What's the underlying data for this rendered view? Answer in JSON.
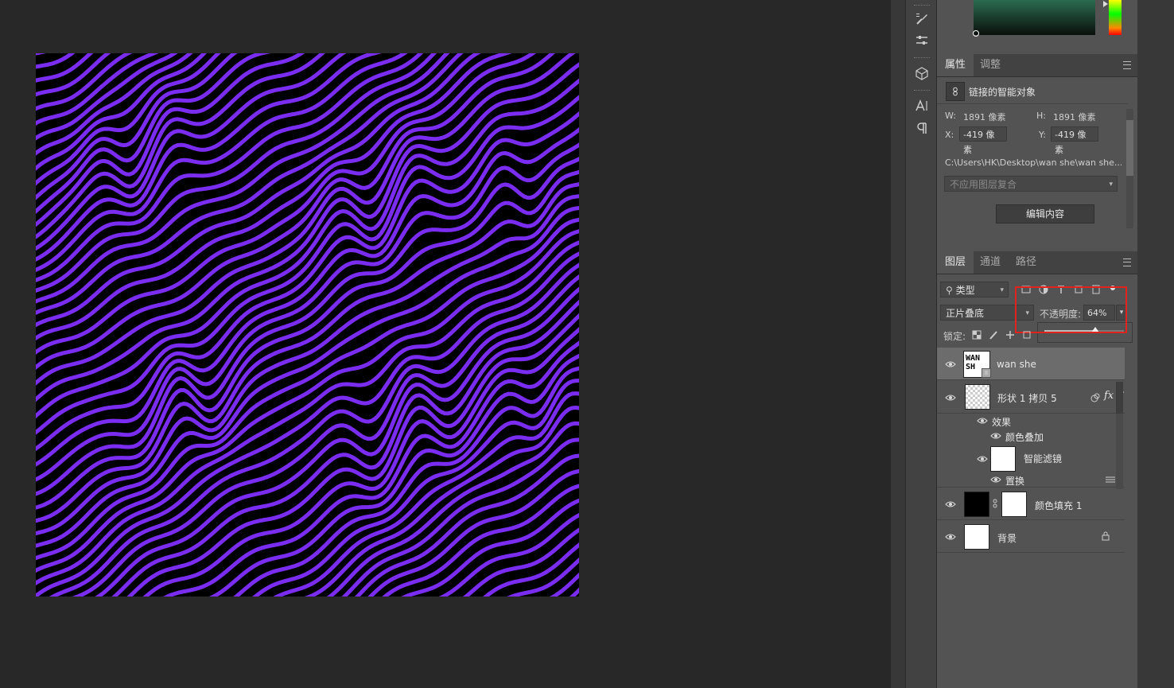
{
  "properties_panel": {
    "tabs": [
      "属性",
      "调整"
    ],
    "object_type": "链接的智能对象",
    "w_label": "W:",
    "w_value": "1891 像素",
    "h_label": "H:",
    "h_value": "1891 像素",
    "x_label": "X:",
    "x_value": "-419 像素",
    "y_label": "Y:",
    "y_value": "-419 像素",
    "path": "C:\\Users\\HK\\Desktop\\wan she\\wan she....",
    "comp_placeholder": "不应用图层复合",
    "edit_button": "编辑内容"
  },
  "layers_panel": {
    "tabs": [
      "图层",
      "通道",
      "路径"
    ],
    "filter_kind": "类型",
    "blend_mode": "正片叠底",
    "opacity_label": "不透明度:",
    "opacity_value": "64%",
    "opacity_fraction": 0.64,
    "lock_label": "锁定:",
    "layers": [
      {
        "name": "wan she",
        "thumb_text": "WAN SH",
        "selected": true
      },
      {
        "name": "形状 1 拷贝 5",
        "fx": "fx"
      },
      {
        "name": "效果"
      },
      {
        "name": "颜色叠加"
      },
      {
        "name": "智能滤镜"
      },
      {
        "name": "置换"
      },
      {
        "name": "颜色填充 1"
      },
      {
        "name": "背景"
      }
    ]
  },
  "colors": {
    "stripe": "#7a2df0",
    "highlight": "#e0241c"
  }
}
